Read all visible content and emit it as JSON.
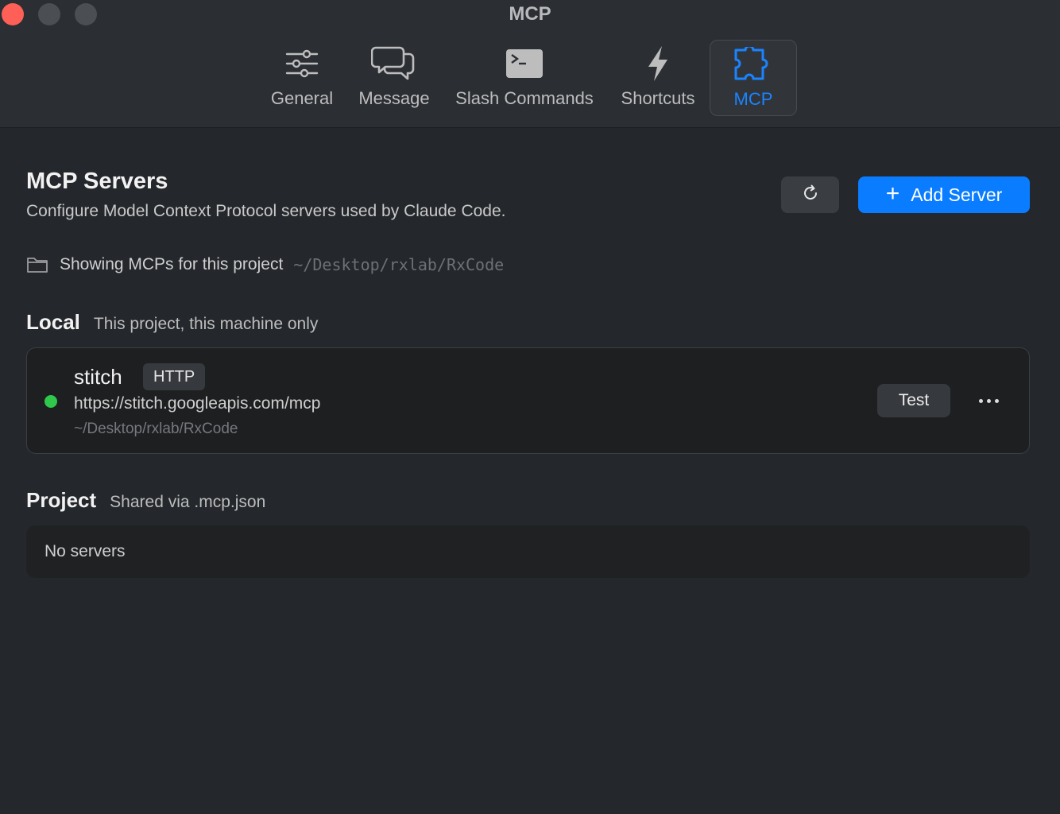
{
  "window": {
    "title": "MCP"
  },
  "tabs": [
    {
      "label": "General",
      "icon": "sliders-icon",
      "active": false
    },
    {
      "label": "Message",
      "icon": "chat-bubbles-icon",
      "active": false
    },
    {
      "label": "Slash Commands",
      "icon": "terminal-icon",
      "active": false
    },
    {
      "label": "Shortcuts",
      "icon": "bolt-icon",
      "active": false
    },
    {
      "label": "MCP",
      "icon": "puzzle-icon",
      "active": true
    }
  ],
  "header": {
    "title": "MCP Servers",
    "subtitle": "Configure Model Context Protocol servers used by Claude Code.",
    "refresh_icon": "refresh-icon",
    "add_plus": "+",
    "add_label": "Add Server"
  },
  "project": {
    "label": "Showing MCPs for this project",
    "path": "~/Desktop/rxlab/RxCode"
  },
  "sections": {
    "local": {
      "name": "Local",
      "description": "This project, this machine only",
      "servers": [
        {
          "name": "stitch",
          "type": "HTTP",
          "url": "https://stitch.googleapis.com/mcp",
          "path": "~/Desktop/rxlab/RxCode",
          "status": "connected",
          "test_label": "Test"
        }
      ]
    },
    "project": {
      "name": "Project",
      "description": "Shared via .mcp.json",
      "empty_text": "No servers"
    }
  },
  "colors": {
    "accent": "#0a7cff",
    "status_ok": "#2fc84b",
    "close": "#fe5f57"
  }
}
